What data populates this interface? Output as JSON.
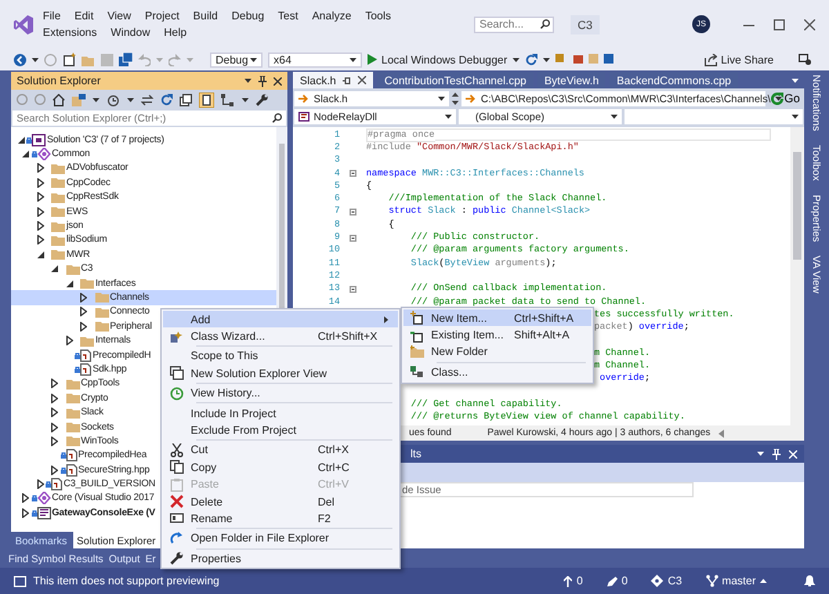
{
  "title_bar": {
    "menu": [
      "File",
      "Edit",
      "View",
      "Project",
      "Build",
      "Debug",
      "Test",
      "Analyze",
      "Tools",
      "Extensions",
      "Window",
      "Help"
    ],
    "search": {
      "placeholder": "Search..."
    },
    "solution_name": "C3",
    "avatar": "JS"
  },
  "toolbar": {
    "configuration": "Debug",
    "platform": "x64",
    "debugger": "Local Windows Debugger",
    "live_share": "Live Share"
  },
  "solution_explorer": {
    "title": "Solution Explorer",
    "search": {
      "placeholder": "Search Solution Explorer (Ctrl+;)"
    },
    "tree": [
      {
        "label": "Solution 'C3' (7 of 7 projects)",
        "kind": "solution",
        "expanded": true,
        "locked": true,
        "selected": false,
        "children": [
          {
            "label": "Common",
            "kind": "project",
            "expanded": true,
            "locked": true,
            "selected": false,
            "children": [
              {
                "label": "ADVobfuscator",
                "kind": "folder",
                "expanded": false,
                "locked": false,
                "selected": false
              },
              {
                "label": "CppCodec",
                "kind": "folder",
                "expanded": false,
                "locked": false,
                "selected": false
              },
              {
                "label": "CppRestSdk",
                "kind": "folder",
                "expanded": false,
                "locked": false,
                "selected": false
              },
              {
                "label": "EWS",
                "kind": "folder",
                "expanded": false,
                "locked": false,
                "selected": false
              },
              {
                "label": "json",
                "kind": "folder",
                "expanded": false,
                "locked": false,
                "selected": false
              },
              {
                "label": "libSodium",
                "kind": "folder",
                "expanded": false,
                "locked": false,
                "selected": false
              },
              {
                "label": "MWR",
                "kind": "folder",
                "expanded": true,
                "locked": false,
                "selected": false,
                "children": [
                  {
                    "label": "C3",
                    "kind": "folder",
                    "expanded": true,
                    "locked": false,
                    "selected": false,
                    "children": [
                      {
                        "label": "Interfaces",
                        "kind": "folder",
                        "expanded": true,
                        "locked": false,
                        "selected": false,
                        "children": [
                          {
                            "label": "Channels",
                            "kind": "folder",
                            "expanded": false,
                            "locked": false,
                            "selected": true
                          },
                          {
                            "label": "Connecto",
                            "kind": "folder",
                            "expanded": false,
                            "locked": false,
                            "selected": false
                          },
                          {
                            "label": "Peripheral",
                            "kind": "folder",
                            "expanded": false,
                            "locked": false,
                            "selected": false
                          }
                        ]
                      },
                      {
                        "label": "Internals",
                        "kind": "folder",
                        "expanded": false,
                        "locked": false,
                        "selected": false
                      },
                      {
                        "label": "PrecompiledH",
                        "kind": "file",
                        "expanded": false,
                        "locked": true,
                        "selected": false
                      },
                      {
                        "label": "Sdk.hpp",
                        "kind": "file",
                        "expanded": false,
                        "locked": true,
                        "selected": false
                      }
                    ]
                  },
                  {
                    "label": "CppTools",
                    "kind": "folder",
                    "expanded": false,
                    "locked": false,
                    "selected": false
                  },
                  {
                    "label": "Crypto",
                    "kind": "folder",
                    "expanded": false,
                    "locked": false,
                    "selected": false
                  },
                  {
                    "label": "Slack",
                    "kind": "folder",
                    "expanded": false,
                    "locked": false,
                    "selected": false
                  },
                  {
                    "label": "Sockets",
                    "kind": "folder",
                    "expanded": false,
                    "locked": false,
                    "selected": false
                  },
                  {
                    "label": "WinTools",
                    "kind": "folder",
                    "expanded": false,
                    "locked": false,
                    "selected": false
                  },
                  {
                    "label": "PrecompiledHea",
                    "kind": "file",
                    "expanded": false,
                    "locked": true,
                    "selected": false
                  },
                  {
                    "label": "SecureString.hpp",
                    "kind": "header",
                    "expanded": false,
                    "locked": true,
                    "selected": false
                  }
                ]
              },
              {
                "label": "C3_BUILD_VERSION",
                "kind": "header",
                "expanded": false,
                "locked": true,
                "selected": false
              }
            ]
          },
          {
            "label": "Core (Visual Studio 2017",
            "kind": "project",
            "expanded": false,
            "locked": true,
            "selected": false
          },
          {
            "label": "GatewayConsoleExe (V",
            "kind": "startup-project",
            "expanded": false,
            "locked": true,
            "selected": false
          }
        ]
      }
    ],
    "tabs": [
      {
        "label": "Bookmarks",
        "selected": false
      },
      {
        "label": "Solution Explorer",
        "selected": true
      }
    ]
  },
  "editor": {
    "tabs": [
      {
        "label": "Slack.h",
        "selected": true
      },
      {
        "label": "ContributionTestChannel.cpp",
        "selected": false
      },
      {
        "label": "ByteView.h",
        "selected": false
      },
      {
        "label": "BackendCommons.cpp",
        "selected": false
      }
    ],
    "file_dropdown": "Slack.h",
    "path": "C:\\ABC\\Repos\\C3\\Src\\Common\\MWR\\C3\\Interfaces\\Channels\\",
    "go_button": "Go",
    "project_dropdown": "NodeRelayDll",
    "scope_dropdown": "(Global Scope)",
    "lines": [
      {
        "number": "1",
        "kind": "current",
        "fold": false,
        "tokens": [
          {
            "kind": "pre",
            "text": "#pragma once"
          }
        ]
      },
      {
        "number": "2",
        "kind": "code",
        "fold": false,
        "tokens": [
          {
            "kind": "pre",
            "text": "#include "
          },
          {
            "kind": "string",
            "text": "\"Common/MWR/Slack/SlackApi.h\""
          }
        ]
      },
      {
        "number": "3",
        "kind": "code",
        "fold": false
      },
      {
        "number": "4",
        "kind": "code",
        "fold": true,
        "tokens": [
          {
            "kind": "keyword",
            "text": "namespace "
          },
          {
            "kind": "type",
            "text": "MWR::C3::Interfaces::Channels"
          }
        ]
      },
      {
        "number": "5",
        "kind": "code",
        "fold": false,
        "tokens": [
          {
            "kind": "plain",
            "text": "{"
          }
        ]
      },
      {
        "number": "6",
        "kind": "code",
        "fold": false,
        "tokens": [
          {
            "kind": "comment",
            "text": "    ///Implementation of the Slack Channel."
          }
        ]
      },
      {
        "number": "7",
        "kind": "code",
        "fold": true,
        "tokens": [
          {
            "kind": "keyword",
            "text": "    struct "
          },
          {
            "kind": "type",
            "text": "Slack"
          },
          {
            "kind": "plain",
            "text": " : "
          },
          {
            "kind": "keyword",
            "text": "public "
          },
          {
            "kind": "type",
            "text": "Channel<Slack>"
          }
        ]
      },
      {
        "number": "8",
        "kind": "code",
        "fold": false,
        "tokens": [
          {
            "kind": "plain",
            "text": "    {"
          }
        ]
      },
      {
        "number": "9",
        "kind": "code",
        "fold": true,
        "tokens": [
          {
            "kind": "comment",
            "text": "        /// Public constructor."
          }
        ]
      },
      {
        "number": "10",
        "kind": "code",
        "fold": false,
        "tokens": [
          {
            "kind": "comment",
            "text": "        /// @param arguments factory arguments."
          }
        ]
      },
      {
        "number": "11",
        "kind": "code",
        "fold": false,
        "tokens": [
          {
            "kind": "type",
            "text": "        Slack"
          },
          {
            "kind": "plain",
            "text": "("
          },
          {
            "kind": "type",
            "text": "ByteView"
          },
          {
            "kind": "param",
            "text": " arguments"
          },
          {
            "kind": "plain",
            "text": ");"
          }
        ]
      },
      {
        "number": "12",
        "kind": "code",
        "fold": false
      },
      {
        "number": "13",
        "kind": "code",
        "fold": true,
        "tokens": [
          {
            "kind": "comment",
            "text": "        /// OnSend callback implementation."
          }
        ]
      },
      {
        "number": "14",
        "kind": "code",
        "fold": false,
        "tokens": [
          {
            "kind": "comment",
            "text": "        /// @param packet data to send to Channel."
          }
        ]
      },
      {
        "kind": "tail",
        "fold": false,
        "tokens": [
          {
            "kind": "comment",
            "text": "tes successfully written."
          }
        ]
      },
      {
        "kind": "tail",
        "fold": false,
        "tokens": [
          {
            "kind": "param",
            "text": "packet"
          },
          {
            "kind": "plain",
            "text": ") "
          },
          {
            "kind": "keyword",
            "text": "override"
          },
          {
            "kind": "plain",
            "text": ";"
          }
        ]
      },
      {
        "kind": "tail",
        "fold": false
      },
      {
        "kind": "tail",
        "fold": false,
        "tokens": [
          {
            "kind": "comment",
            "text": "m Channel."
          }
        ]
      },
      {
        "kind": "tail",
        "fold": false,
        "tokens": [
          {
            "kind": "comment",
            "text": "m Channel."
          }
        ]
      },
      {
        "kind": "tail",
        "fold": false,
        "tokens": [
          {
            "kind": "keyword",
            "text": " override"
          },
          {
            "kind": "plain",
            "text": ";"
          }
        ]
      },
      {
        "kind": "code",
        "fold": false
      },
      {
        "kind": "code",
        "fold": false,
        "tokens": [
          {
            "kind": "comment",
            "text": "        /// Get channel capability."
          }
        ]
      },
      {
        "kind": "code",
        "fold": false,
        "tokens": [
          {
            "kind": "comment",
            "text": "        /// @returns ByteView view of channel capability."
          }
        ]
      }
    ],
    "issues": "ues found",
    "blame": "Pawel Kurowski, 4 hours ago | 3 authors, 6 changes"
  },
  "bottom_panel": {
    "title": "lts",
    "column": "de Issue"
  },
  "side_tabs": [
    "Notifications",
    "Toolbox",
    "Properties",
    "VA View"
  ],
  "bottom_tabs": [
    "Find Symbol Results",
    "Output",
    "Er"
  ],
  "context_menu": [
    {
      "kind": "item",
      "label": "Add",
      "submenu": true,
      "selected": true,
      "disabled": false
    },
    {
      "kind": "item",
      "label": "Class Wizard...",
      "shortcut": "Ctrl+Shift+X",
      "submenu": false,
      "selected": false,
      "disabled": false
    },
    {
      "kind": "separator"
    },
    {
      "kind": "item",
      "label": "Scope to This",
      "submenu": false,
      "selected": false,
      "disabled": false
    },
    {
      "kind": "item",
      "label": "New Solution Explorer View",
      "submenu": false,
      "selected": false,
      "disabled": false
    },
    {
      "kind": "separator"
    },
    {
      "kind": "item",
      "label": "View History...",
      "submenu": false,
      "selected": false,
      "disabled": false
    },
    {
      "kind": "separator"
    },
    {
      "kind": "item",
      "label": "Include In Project",
      "submenu": false,
      "selected": false,
      "disabled": false
    },
    {
      "kind": "item",
      "label": "Exclude From Project",
      "submenu": false,
      "selected": false,
      "disabled": false
    },
    {
      "kind": "separator"
    },
    {
      "kind": "item",
      "label": "Cut",
      "shortcut": "Ctrl+X",
      "submenu": false,
      "selected": false,
      "disabled": false
    },
    {
      "kind": "item",
      "label": "Copy",
      "shortcut": "Ctrl+C",
      "submenu": false,
      "selected": false,
      "disabled": false
    },
    {
      "kind": "item",
      "label": "Paste",
      "shortcut": "Ctrl+V",
      "submenu": false,
      "selected": false,
      "disabled": true
    },
    {
      "kind": "item",
      "label": "Delete",
      "shortcut": "Del",
      "submenu": false,
      "selected": false,
      "disabled": false
    },
    {
      "kind": "item",
      "label": "Rename",
      "shortcut": "F2",
      "submenu": false,
      "selected": false,
      "disabled": false
    },
    {
      "kind": "separator"
    },
    {
      "kind": "item",
      "label": "Open Folder in File Explorer",
      "submenu": false,
      "selected": false,
      "disabled": false
    },
    {
      "kind": "separator"
    },
    {
      "kind": "item",
      "label": "Properties",
      "submenu": false,
      "selected": false,
      "disabled": false
    }
  ],
  "submenu": [
    {
      "kind": "item",
      "label": "New Item...",
      "shortcut": "Ctrl+Shift+A",
      "selected": true
    },
    {
      "kind": "item",
      "label": "Existing Item...",
      "shortcut": "Shift+Alt+A",
      "selected": false
    },
    {
      "kind": "item",
      "label": "New Folder",
      "selected": false
    },
    {
      "kind": "separator"
    },
    {
      "kind": "item",
      "label": "Class...",
      "selected": false
    }
  ],
  "status_bar": {
    "message": "This item does not support previewing",
    "pushes": "0",
    "edits": "0",
    "repo": "C3",
    "branch": "master"
  }
}
